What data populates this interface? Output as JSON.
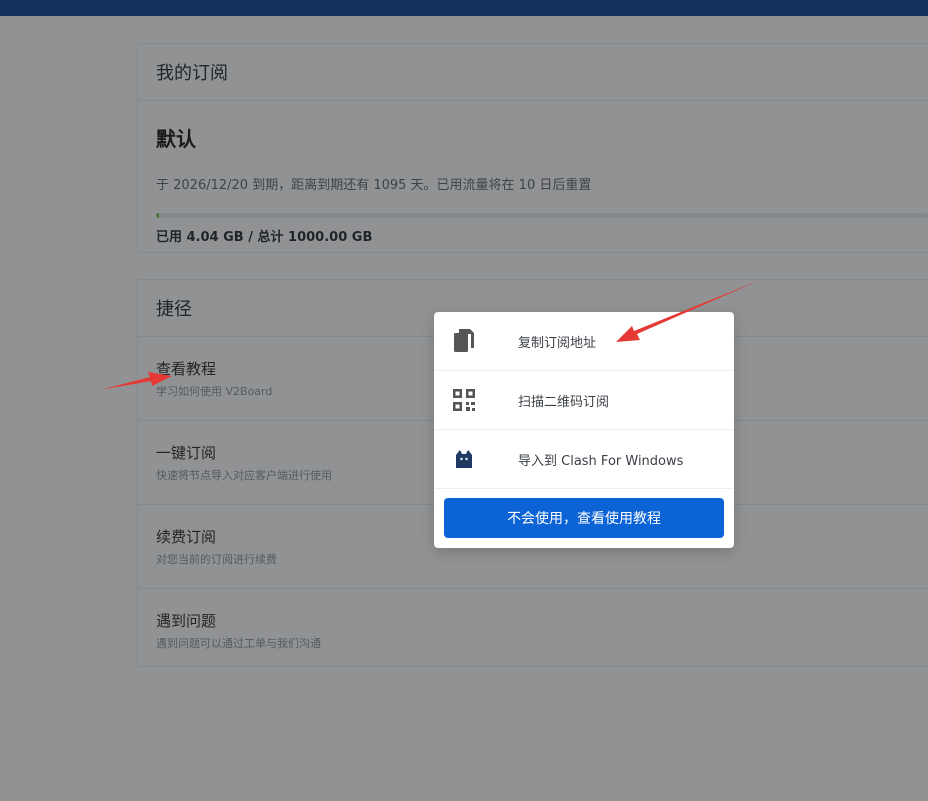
{
  "subscription": {
    "header": "我的订阅",
    "plan_name": "默认",
    "description": "于 2026/12/20 到期，距离到期还有 1095 天。已用流量将在 10 日后重置",
    "usage_text": "已用 4.04 GB / 总计 1000.00 GB",
    "usage_fraction": 0.004,
    "progress_color": "#7cc24a"
  },
  "shortcuts": {
    "header": "捷径",
    "items": [
      {
        "title": "查看教程",
        "desc": "学习如何使用 V2Board"
      },
      {
        "title": "一键订阅",
        "desc": "快速将节点导入对应客户端进行使用"
      },
      {
        "title": "续费订阅",
        "desc": "对您当前的订阅进行续费"
      },
      {
        "title": "遇到问题",
        "desc": "遇到问题可以通过工单与我们沟通"
      }
    ]
  },
  "popup": {
    "items": [
      {
        "label": "复制订阅地址",
        "icon": "copy-icon"
      },
      {
        "label": "扫描二维码订阅",
        "icon": "qrcode-icon"
      },
      {
        "label": "导入到 Clash For Windows",
        "icon": "clash-cat-icon"
      }
    ],
    "button_label": "不会使用，查看使用教程",
    "button_color": "#0b63d6"
  },
  "colors": {
    "topbar": "#0b3d91",
    "arrow": "#e53935"
  }
}
